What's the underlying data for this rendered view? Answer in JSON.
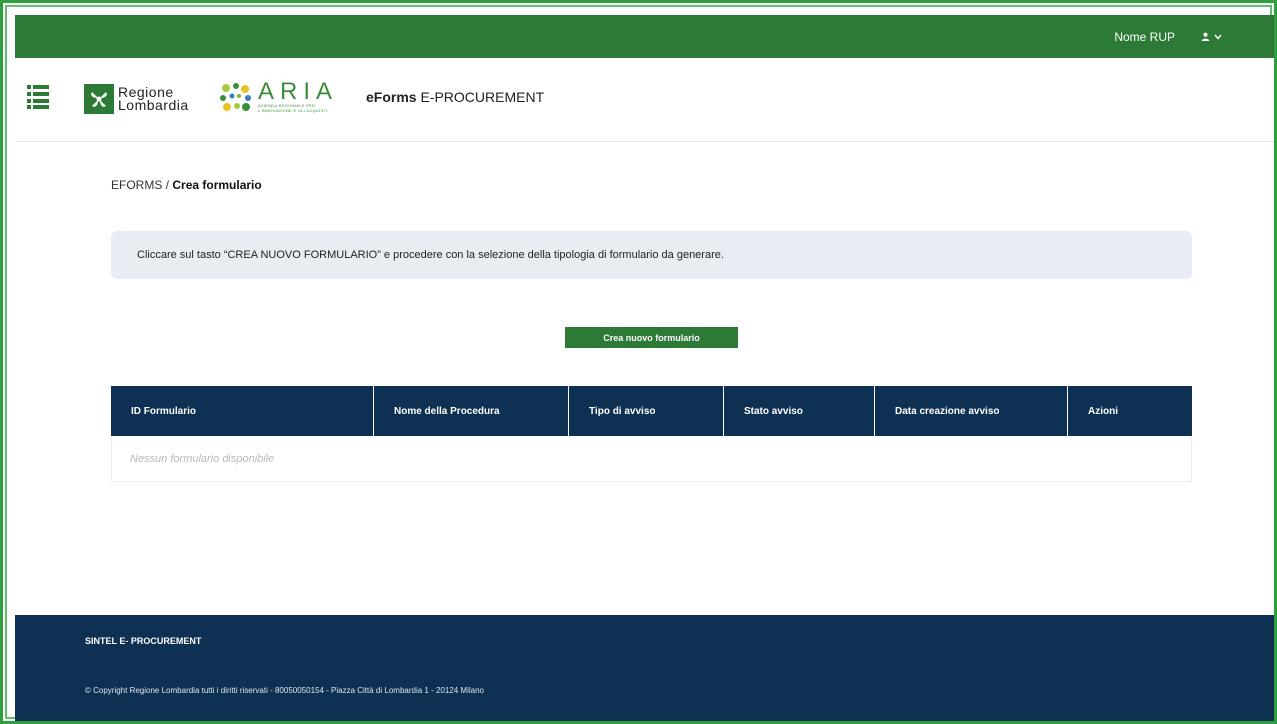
{
  "topbar": {
    "user_name": "Nome RUP",
    "user_icon": "user-icon",
    "chevron_icon": "chevron-down-icon"
  },
  "header": {
    "menu_icon": "hamburger-menu-icon",
    "logo_regione_line1": "Regione",
    "logo_regione_line2": "Lombardia",
    "logo_aria_name": "ARIA",
    "logo_aria_tag1": "AZIENDA REGIONALE PER",
    "logo_aria_tag2": "L'INNOVAZIONE E GLI ACQUISTI",
    "app_title_bold": "eForms",
    "app_title_rest": " E-PROCUREMENT"
  },
  "breadcrumb": {
    "root": "EFORMS",
    "separator": " / ",
    "current": "Crea formulario"
  },
  "info_message": "Cliccare sul tasto “CREA NUOVO FORMULARIO” e procedere con la selezione della tipologia di formulario da generare.",
  "create_button_label": "Crea nuovo formulario",
  "table": {
    "columns": [
      "ID Formulario",
      "Nome della Procedura",
      "Tipo di avviso",
      "Stato avviso",
      "Data creazione avviso",
      "Azioni"
    ],
    "empty_message": "Nessun formulario disponibile"
  },
  "footer": {
    "title": "SINTEL E- PROCUREMENT",
    "copyright": "© Copyright Regione Lombardia tutti i diritti riservati - 80050050154 - Piazza Città di Lombardia 1 - 20124 Milano"
  },
  "colors": {
    "brand_green": "#2d7a36",
    "navy": "#0e3052",
    "info_bg": "#e8ecf3"
  }
}
